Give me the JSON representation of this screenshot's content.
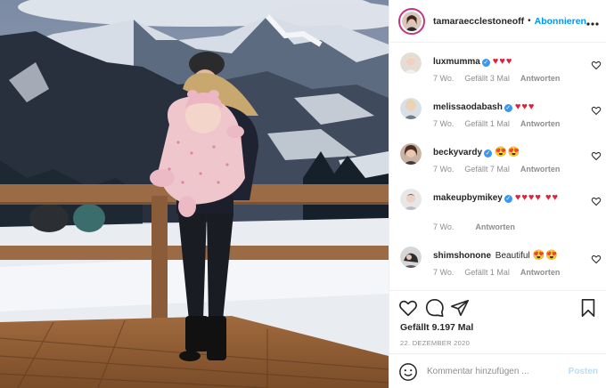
{
  "post": {
    "username": "tamaraecclestoneoff",
    "follow_label": "Abonnieren",
    "separator": "•",
    "more_icon": "more-horizontal-icon",
    "likes_text": "Gefällt 9.197 Mal",
    "date": "22. DEZEMBER 2020"
  },
  "comments": [
    {
      "user": "luxmumma",
      "verified": true,
      "text": "",
      "hearts": "♥♥♥",
      "time": "7 Wo.",
      "likes": "Gefällt 3 Mal",
      "reply": "Antworten"
    },
    {
      "user": "melissaodabash",
      "verified": true,
      "text": "",
      "hearts": "♥♥♥",
      "time": "7 Wo.",
      "likes": "Gefällt 1 Mal",
      "reply": "Antworten"
    },
    {
      "user": "beckyvardy",
      "verified": true,
      "text": "",
      "hearts": "😍😍",
      "time": "7 Wo.",
      "likes": "Gefällt 7 Mal",
      "reply": "Antworten"
    },
    {
      "user": "makeupbymikey",
      "verified": true,
      "text": "",
      "hearts": "♥♥♥♥ ♥♥",
      "time": "7 Wo.",
      "likes": "",
      "reply": "Antworten"
    },
    {
      "user": "shimshonone",
      "verified": false,
      "text": "Beautiful",
      "hearts": "😍😍",
      "time": "7 Wo.",
      "likes": "Gefällt 1 Mal",
      "reply": "Antworten"
    }
  ],
  "composer": {
    "placeholder": "Kommentar hinzufügen ...",
    "post_label": "Posten"
  },
  "colors": {
    "accent": "#0095f6",
    "heart": "#e0213a",
    "muted": "#8e8e8e",
    "post_disabled": "#b2dffc"
  }
}
